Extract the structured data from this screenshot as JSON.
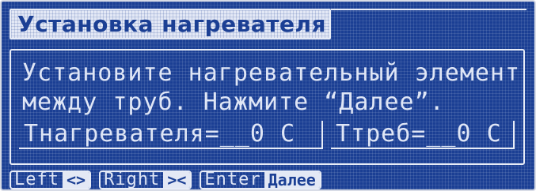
{
  "title": "Установка нагревателя",
  "message": {
    "line1": "Установите нагревательный элемент",
    "line2": "между труб. Нажмите “Далее”."
  },
  "fields": {
    "heater_temp": "Tнагревателя=__0 C",
    "required_temp": "Tтреб=__0 C"
  },
  "softkeys": [
    {
      "label": "Left",
      "action": "<>"
    },
    {
      "label": "Right",
      "action": "><"
    },
    {
      "label": "Enter",
      "action": "Далее"
    }
  ],
  "colors": {
    "background": "#1b3f94",
    "foreground": "#dfe6f6",
    "highlight": "#e3e8f5"
  }
}
